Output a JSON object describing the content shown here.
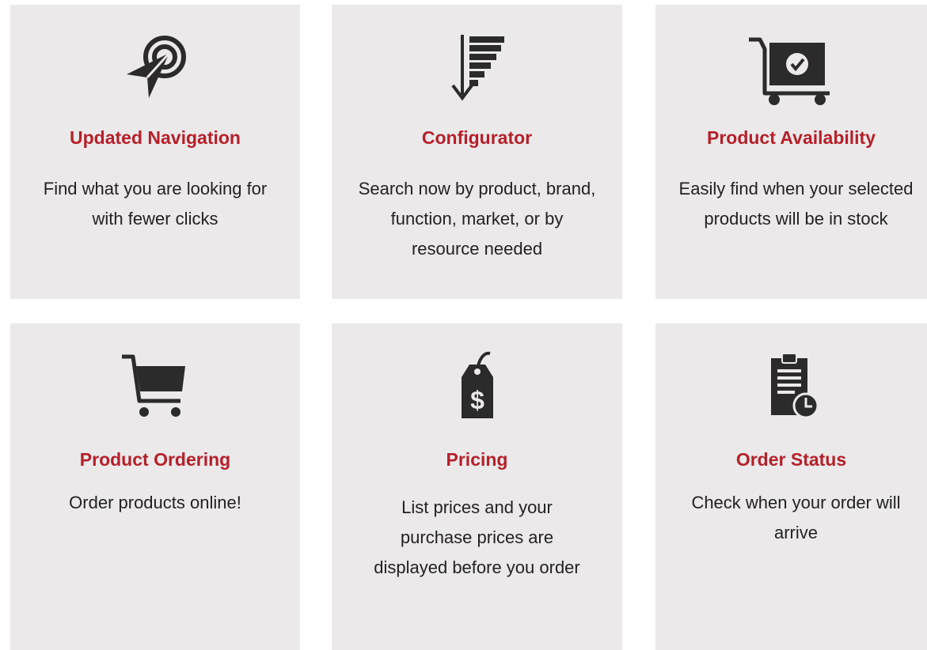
{
  "features": [
    {
      "icon": "pointer-target-icon",
      "title": "Updated Navigation",
      "description": "Find what you are looking for with fewer clicks"
    },
    {
      "icon": "filter-sort-icon",
      "title": "Configurator",
      "description": "Search now by product, brand, function, market, or by resource needed"
    },
    {
      "icon": "cart-check-icon",
      "title": "Product Availability",
      "description": "Easily find when your selected products will be in stock"
    },
    {
      "icon": "shopping-cart-icon",
      "title": "Product Ordering",
      "description": "Order products online!"
    },
    {
      "icon": "price-tag-icon",
      "title": "Pricing",
      "description": "List prices and your purchase prices are displayed before you order"
    },
    {
      "icon": "clipboard-clock-icon",
      "title": "Order Status",
      "description": "Check when your order will arrive"
    }
  ],
  "colors": {
    "card_background": "#ebe9ea",
    "title_color": "#b5202a",
    "text_color": "#222222",
    "icon_color": "#2b2b2b"
  }
}
